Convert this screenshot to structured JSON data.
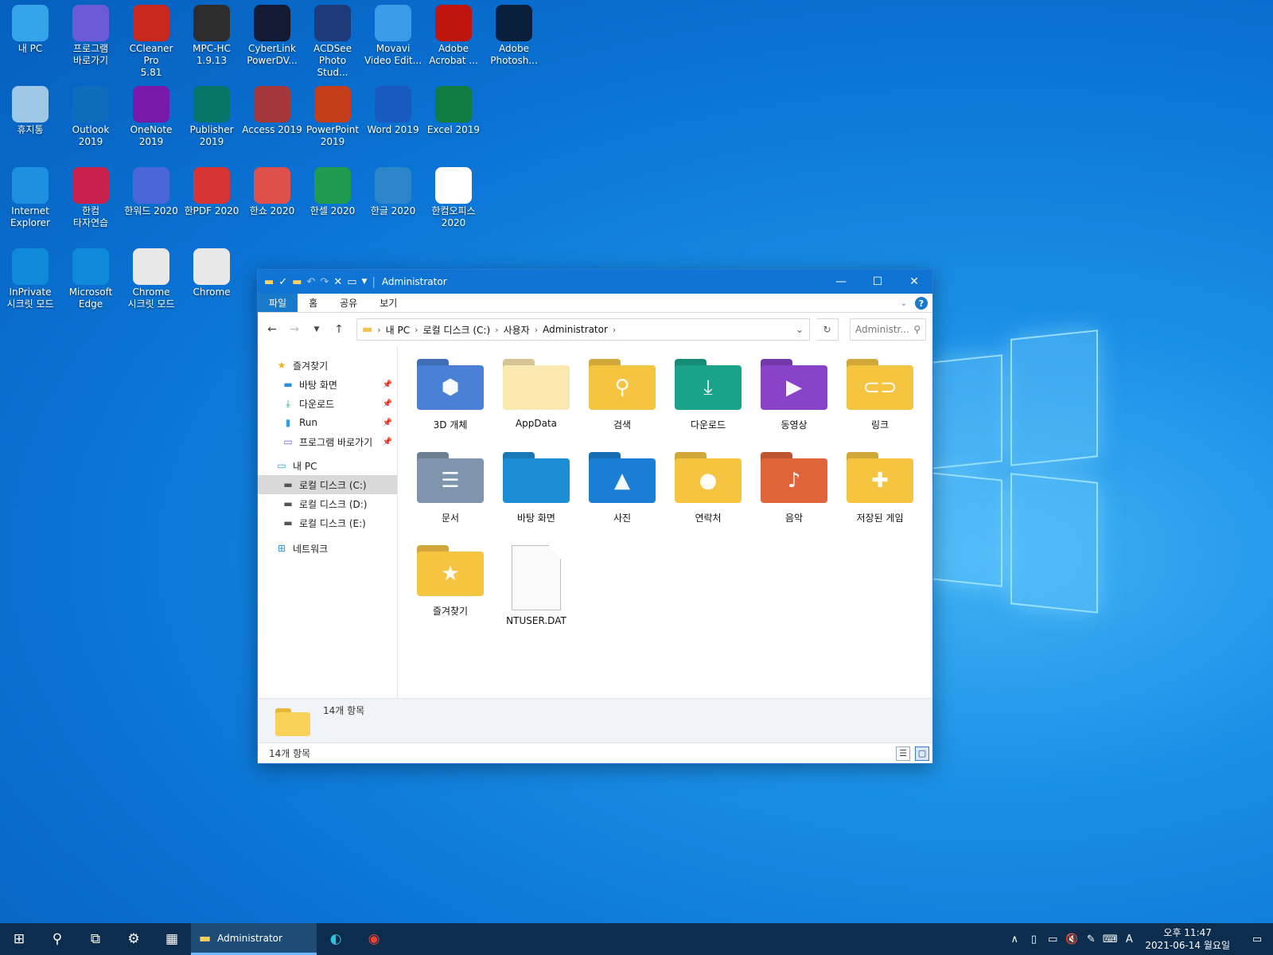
{
  "desktop": {
    "icons": [
      {
        "label": "내 PC",
        "icon": "monitor-icon",
        "color": "#35a3e8"
      },
      {
        "label": "프로그램\n바로가기",
        "icon": "tv-icon",
        "color": "#6b5bd6"
      },
      {
        "label": "CCleaner Pro\n5.81",
        "icon": "ccleaner-icon",
        "color": "#c9281e"
      },
      {
        "label": "MPC-HC\n1.9.13",
        "icon": "mpc-icon",
        "color": "#2d2d2d"
      },
      {
        "label": "CyberLink\nPowerDV...",
        "icon": "powerdvd-icon",
        "color": "#141a34"
      },
      {
        "label": "ACDSee\nPhoto Stud...",
        "icon": "acdsee-icon",
        "color": "#1d3b7a"
      },
      {
        "label": "Movavi\nVideo Edit...",
        "icon": "movavi-icon",
        "color": "#3a9be8"
      },
      {
        "label": "Adobe\nAcrobat ...",
        "icon": "acrobat-icon",
        "color": "#c0150f"
      },
      {
        "label": "Adobe\nPhotosh...",
        "icon": "photoshop-icon",
        "color": "#0a1f3c"
      },
      {
        "label": "휴지통",
        "icon": "recycle-bin-icon",
        "color": "#9fc8e6"
      },
      {
        "label": "Outlook\n2019",
        "icon": "outlook-icon",
        "color": "#0f6cbd"
      },
      {
        "label": "OneNote\n2019",
        "icon": "onenote-icon",
        "color": "#7719aa"
      },
      {
        "label": "Publisher\n2019",
        "icon": "publisher-icon",
        "color": "#077568"
      },
      {
        "label": "Access 2019",
        "icon": "access-icon",
        "color": "#a4373a"
      },
      {
        "label": "PowerPoint\n2019",
        "icon": "powerpoint-icon",
        "color": "#c43e1c"
      },
      {
        "label": "Word 2019",
        "icon": "word-icon",
        "color": "#185abd"
      },
      {
        "label": "Excel 2019",
        "icon": "excel-icon",
        "color": "#107c41"
      },
      {
        "label": "Internet\nExplorer",
        "icon": "ie-icon",
        "color": "#1e90e0"
      },
      {
        "label": "한컴\n타자연습",
        "icon": "hancom-typing-icon",
        "color": "#c8204a"
      },
      {
        "label": "한워드 2020",
        "icon": "hanword-icon",
        "color": "#4a66d8"
      },
      {
        "label": "한PDF 2020",
        "icon": "hanpdf-icon",
        "color": "#d93434"
      },
      {
        "label": "한쇼 2020",
        "icon": "hanshow-icon",
        "color": "#e0504a"
      },
      {
        "label": "한셀 2020",
        "icon": "hancell-icon",
        "color": "#1f9a4f"
      },
      {
        "label": "한글 2020",
        "icon": "hangul-icon",
        "color": "#2a86c8"
      },
      {
        "label": "한컴오피스\n2020",
        "icon": "hancom-office-icon",
        "color": "#ffffff"
      },
      {
        "label": "InPrivate\n시크릿 모드",
        "icon": "edge-inprivate-icon",
        "color": "#0f8ad8"
      },
      {
        "label": "Microsoft\nEdge",
        "icon": "edge-icon",
        "color": "#0f8ad8"
      },
      {
        "label": "Chrome\n시크릿 모드",
        "icon": "chrome-incognito-icon",
        "color": "#e8e8e8"
      },
      {
        "label": "Chrome",
        "icon": "chrome-icon",
        "color": "#e8e8e8"
      }
    ]
  },
  "explorer": {
    "title": "Administrator",
    "ribbon_tabs": [
      "파일",
      "홈",
      "공유",
      "보기"
    ],
    "breadcrumb": [
      "내 PC",
      "로컬 디스크 (C:)",
      "사용자",
      "Administrator"
    ],
    "search_placeholder": "Administr...",
    "nav": {
      "quick_access": "즐겨찾기",
      "pinned": [
        "바탕 화면",
        "다운로드",
        "Run",
        "프로그램 바로가기"
      ],
      "this_pc": "내 PC",
      "drives": [
        "로컬 디스크 (C:)",
        "로컬 디스크 (D:)",
        "로컬 디스크 (E:)"
      ],
      "network": "네트워크"
    },
    "items": [
      {
        "name": "3D 개체",
        "color": "#4a80d6",
        "glyph": "⬢"
      },
      {
        "name": "AppData",
        "color": "#fbe8b0",
        "glyph": ""
      },
      {
        "name": "검색",
        "color": "#f5c542",
        "glyph": "⚲"
      },
      {
        "name": "다운로드",
        "color": "#1aa38a",
        "glyph": "⤓"
      },
      {
        "name": "동영상",
        "color": "#8a42c8",
        "glyph": "▶"
      },
      {
        "name": "링크",
        "color": "#f5c542",
        "glyph": "⊂⊃"
      },
      {
        "name": "문서",
        "color": "#7f95ad",
        "glyph": "☰"
      },
      {
        "name": "바탕 화면",
        "color": "#1d8ed6",
        "glyph": ""
      },
      {
        "name": "사진",
        "color": "#1a7fd4",
        "glyph": "▲"
      },
      {
        "name": "연락처",
        "color": "#f5c542",
        "glyph": "●"
      },
      {
        "name": "음악",
        "color": "#e0643a",
        "glyph": "♪"
      },
      {
        "name": "저장된 게임",
        "color": "#f5c542",
        "glyph": "✚"
      },
      {
        "name": "즐겨찾기",
        "color": "#f5c542",
        "glyph": "★"
      },
      {
        "name": "NTUSER.DAT",
        "color": "#fafafa",
        "glyph": "file"
      }
    ],
    "details_count": "14개 항목",
    "status_count": "14개 항목"
  },
  "taskbar": {
    "app_label": "Administrator",
    "time": "오후 11:47",
    "date": "2021-06-14 월요일",
    "ime": "A"
  }
}
